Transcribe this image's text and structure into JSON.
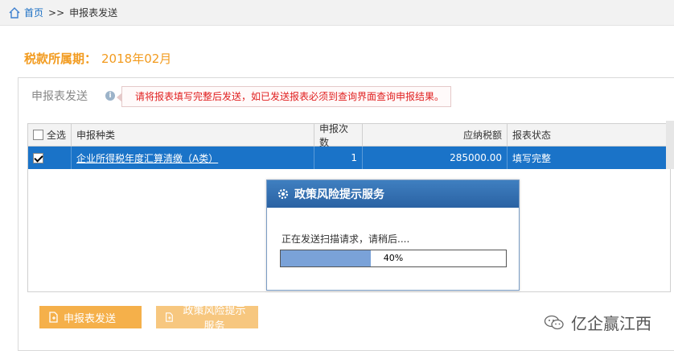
{
  "breadcrumb": {
    "home": "首页",
    "separator": ">>",
    "current": "申报表发送"
  },
  "period": {
    "label": "税款所属期：",
    "value": "2018年02月"
  },
  "panel": {
    "title": "申报表发送",
    "notice": "请将报表填写完整后发送，如已发送报表必须到查询界面查询申报结果。"
  },
  "table": {
    "headers": {
      "select_all": "全选",
      "type": "申报种类",
      "count": "申报次数",
      "tax": "应纳税额",
      "status": "报表状态"
    },
    "rows": [
      {
        "checked": true,
        "type": "企业所得税年度汇算清缴（A类）",
        "count": "1",
        "tax": "285000.00",
        "status": "填写完整"
      }
    ]
  },
  "dialog": {
    "title": "政策风险提示服务",
    "message": "正在发送扫描请求，请稍后....",
    "progress_percent": 40,
    "progress_label": "40%"
  },
  "buttons": {
    "send": "申报表发送",
    "policy": "政策风险提示服务"
  },
  "watermark": "亿企赢江西",
  "colors": {
    "accent_orange": "#f29b1f",
    "selected_row": "#1a73c8",
    "notice_red": "#e02020",
    "button_orange": "#f5b04a"
  }
}
